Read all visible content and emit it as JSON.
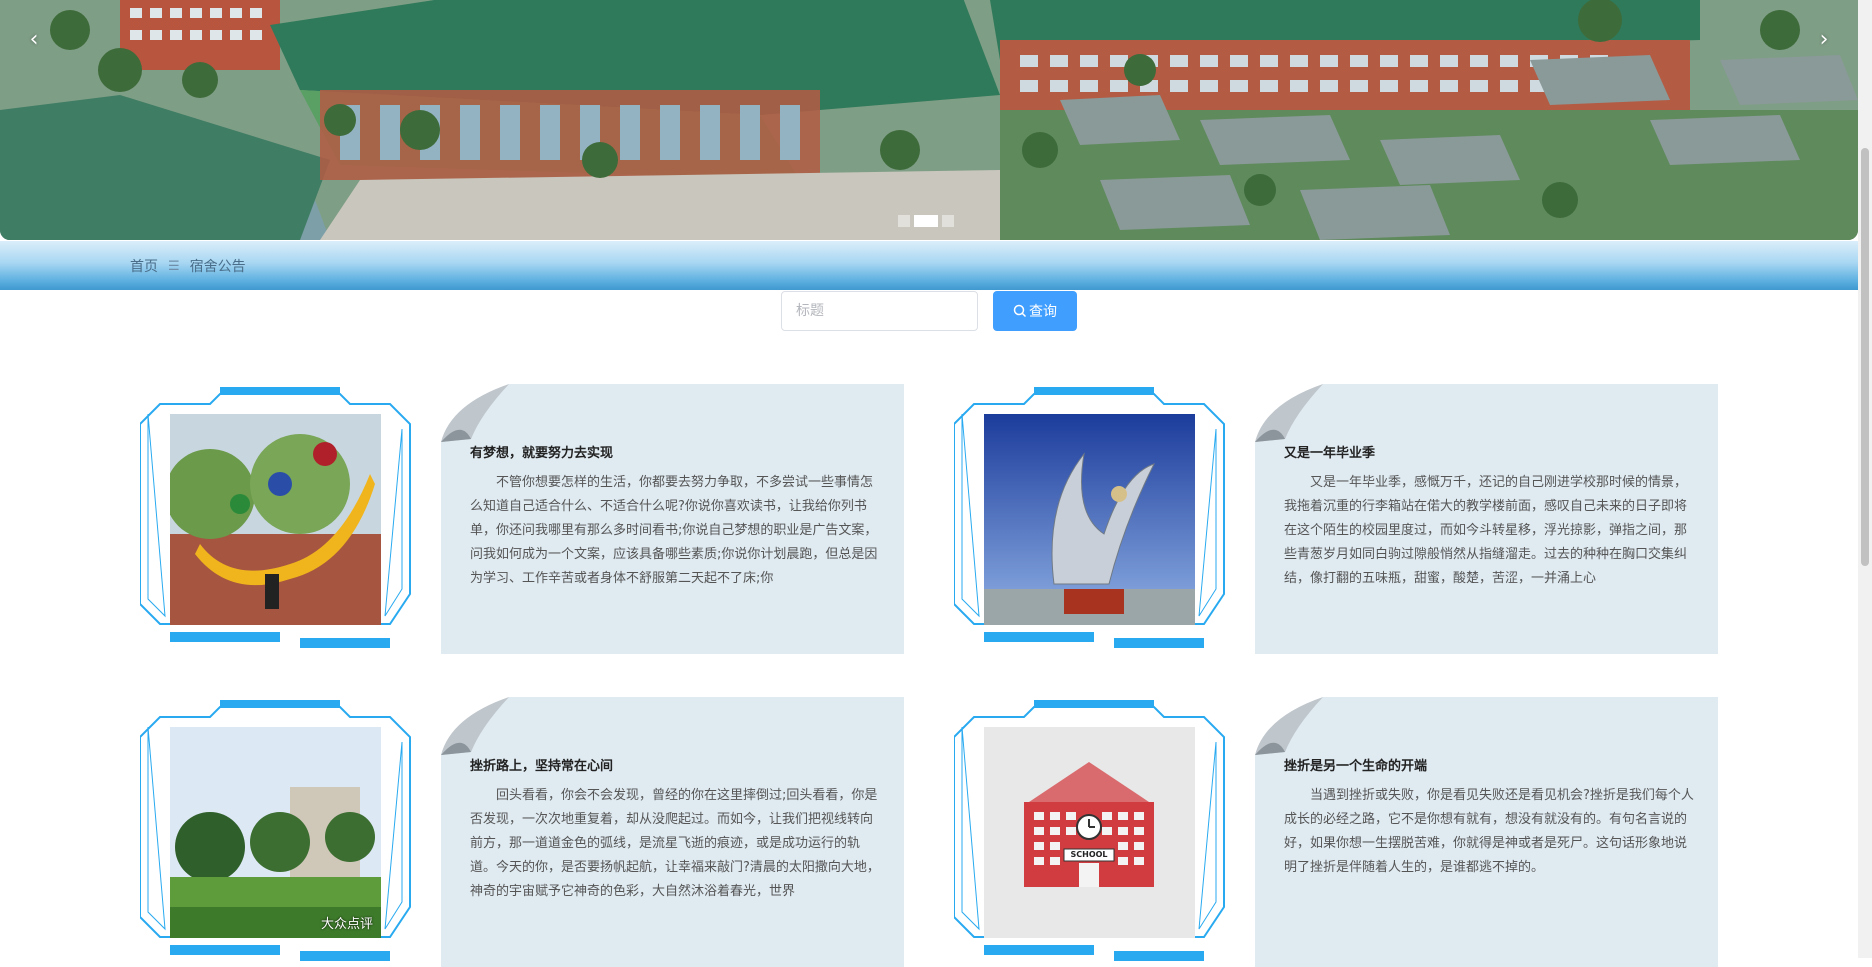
{
  "carousel": {
    "prev_icon": "‹",
    "next_icon": "›",
    "slides": 3,
    "active_slide": 2
  },
  "breadcrumb": {
    "home": "首页",
    "separator": "☰",
    "current": "宿舍公告"
  },
  "search": {
    "placeholder": "标题",
    "button_label": "查询"
  },
  "colors": {
    "accent": "#409eff",
    "panel_bg": "#dfeaf1",
    "frame_blue": "#22a6ee"
  },
  "notices": [
    {
      "title": "有梦想，就要努力去实现",
      "text": "不管你想要怎样的生活，你都要去努力争取，不多尝试一些事情怎么知道自己适合什么、不适合什么呢?你说你喜欢读书，让我给你列书单，你还问我哪里有那么多时间看书;你说自己梦想的职业是广告文案，问我如何成为一个文案，应该具备哪些素质;你说你计划晨跑，但总是因为学习、工作辛苦或者身体不舒服第二天起不了床;你",
      "image": "bicycle-sculpture-photo"
    },
    {
      "title": "又是一年毕业季",
      "text": "又是一年毕业季，感慨万千，还记的自己刚进学校那时候的情景，我拖着沉重的行李箱站在偌大的教学楼前面，感叹自己未来的日子即将在这个陌生的校园里度过，而如今斗转星移，浮光掠影，弹指之间，那些青葱岁月如同白驹过隙般悄然从指缝溜走。过去的种种在胸口交集纠结，像打翻的五味瓶，甜蜜，酸楚，苦涩，一并涌上心",
      "image": "campus-sculpture-photo"
    },
    {
      "title": "挫折路上，坚持常在心间",
      "text": "回头看看，你会不会发现，曾经的你在这里摔倒过;回头看看，你是否发现，一次次地重复着，却从没爬起过。而如今，让我们把视线转向前方，那一道道金色的弧线，是流星飞逝的痕迹，或是成功运行的轨道。今天的你，是否要扬帆起航，让幸福来敲门?清晨的太阳撒向大地，神奇的宇宙赋予它神奇的色彩，大自然沐浴着春光，世界",
      "image": "campus-garden-photo",
      "watermark": "大众点评"
    },
    {
      "title": "挫折是另一个生命的开端",
      "text": "当遇到挫折或失败，你是看见失败还是看见机会?挫折是我们每个人成长的必经之路，它不是你想有就有，想没有就没有的。有句名言说的好，如果你想一生摆脱苦难，你就得是神或者是死尸。这句话形象地说明了挫折是伴随着人生的，是谁都逃不掉的。",
      "image": "school-building-icon",
      "school_sign": "SCHOOL"
    }
  ]
}
